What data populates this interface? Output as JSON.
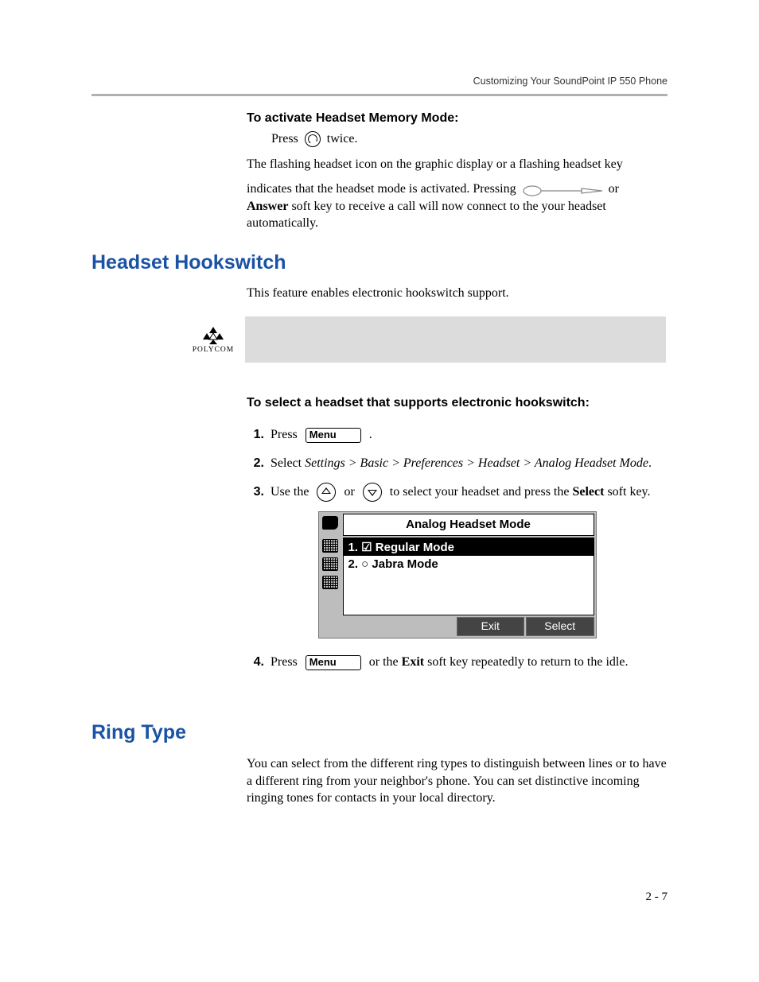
{
  "header": {
    "running_title": "Customizing Your SoundPoint IP 550 Phone"
  },
  "sec1": {
    "title": "To activate Headset Memory Mode:",
    "press": "Press",
    "twice": "twice.",
    "p1": "The flashing headset icon on the graphic display or a flashing headset key",
    "p2a": "indicates that the headset mode is activated. Pressing",
    "p2b": "or",
    "p3": "Answer",
    "p3b": " soft key to receive a call will now connect to the your headset automatically."
  },
  "hookswitch": {
    "heading": "Headset Hookswitch",
    "intro": "This feature enables electronic hookswitch support.",
    "logo_text": "POLYCOM",
    "subhead": "To select a headset that supports electronic hookswitch:",
    "steps": {
      "n1": "1.",
      "s1a": "Press",
      "s1b": ".",
      "n2": "2.",
      "s2a": "Select ",
      "s2b": "Settings > Basic > Preferences > Headset > Analog Headset Mode",
      "s2c": ".",
      "n3": "3.",
      "s3a": "Use the",
      "s3b": "or",
      "s3c": "to select your headset and press the ",
      "s3d": "Select",
      "s3e": " soft key.",
      "n4": "4.",
      "s4a": "Press",
      "s4b": " or the ",
      "s4c": "Exit",
      "s4d": " soft key repeatedly to return to the idle."
    },
    "menu_label": "Menu",
    "lcd": {
      "title": "Analog Headset Mode",
      "opt1": "1. ☑  Regular Mode",
      "opt2": "2. ○  Jabra Mode",
      "soft_exit": "Exit",
      "soft_select": "Select"
    }
  },
  "ringtype": {
    "heading": "Ring Type",
    "p": "You can select from the different ring types to distinguish between lines or to have a different ring from your neighbor's phone. You can set distinctive incoming ringing tones for contacts in your local directory."
  },
  "page_num": "2 - 7"
}
